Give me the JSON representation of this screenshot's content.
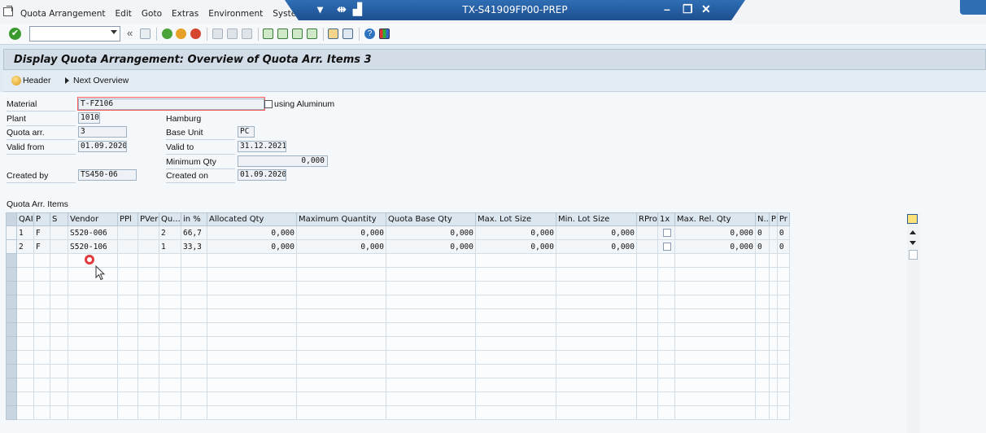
{
  "menu": {
    "items": [
      "Quota Arrangement",
      "Edit",
      "Goto",
      "Extras",
      "Environment",
      "System"
    ]
  },
  "window": {
    "system_title": "TX-S41909FP00-PREP"
  },
  "toolbar": {
    "command_field_value": ""
  },
  "screen": {
    "title": "Display Quota Arrangement: Overview of Quota Arr. Items 3"
  },
  "app_toolbar": {
    "header_label": "Header",
    "next_overview_label": "Next Overview"
  },
  "form": {
    "material": {
      "label": "Material",
      "value": "T-FZ106",
      "description": "using Aluminum"
    },
    "plant": {
      "label": "Plant",
      "value": "1010",
      "description": "Hamburg"
    },
    "quota_arr": {
      "label": "Quota arr.",
      "value": "3"
    },
    "base_unit": {
      "label": "Base Unit",
      "value": "PC"
    },
    "valid_from": {
      "label": "Valid from",
      "value": "01.09.2020"
    },
    "valid_to": {
      "label": "Valid to",
      "value": "31.12.2021"
    },
    "minimum_qty": {
      "label": "Minimum Qty",
      "value": "0,000"
    },
    "created_by": {
      "label": "Created by",
      "value": "TS450-06"
    },
    "created_on": {
      "label": "Created on",
      "value": "01.09.2020"
    }
  },
  "table": {
    "title": "Quota Arr. Items",
    "columns": [
      "QAI",
      "P",
      "S",
      "Vendor",
      "PPl",
      "PVer",
      "Qu...",
      "in %",
      "Allocated Qty",
      "Maximum Quantity",
      "Quota Base Qty",
      "Max. Lot Size",
      "Min. Lot Size",
      "RPro",
      "1x",
      "Max. Rel. Qty",
      "N..",
      "P",
      "Pr"
    ],
    "rows": [
      {
        "qai": "1",
        "p": "F",
        "s": "",
        "vendor": "S520-006",
        "ppl": "",
        "pver": "",
        "quota": "2",
        "pct": "66,7",
        "allocated": "0,000",
        "max_qty": "0,000",
        "base_qty": "0,000",
        "max_lot": "0,000",
        "min_lot": "0,000",
        "rpro": "",
        "max_rel": "0,000",
        "n": "0",
        "p2": "",
        "pr": "0"
      },
      {
        "qai": "2",
        "p": "F",
        "s": "",
        "vendor": "S520-106",
        "ppl": "",
        "pver": "",
        "quota": "1",
        "pct": "33,3",
        "allocated": "0,000",
        "max_qty": "0,000",
        "base_qty": "0,000",
        "max_lot": "0,000",
        "min_lot": "0,000",
        "rpro": "",
        "max_rel": "0,000",
        "n": "0",
        "p2": "",
        "pr": "0"
      }
    ]
  }
}
